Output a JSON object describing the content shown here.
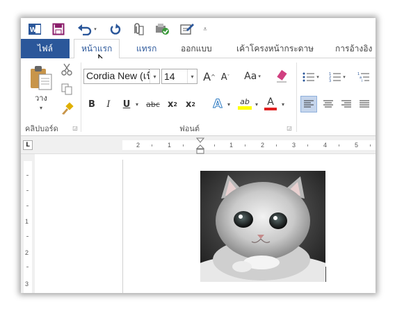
{
  "qat": {
    "icons": [
      "word-logo-icon",
      "save-icon",
      "undo-icon",
      "redo-icon",
      "attach-icon",
      "check-icon",
      "edit-icon",
      "customize-icon"
    ]
  },
  "tabs": {
    "file": "ไฟล์",
    "home": "หน้าแรก",
    "insert": "แทรก",
    "design": "ออกแบบ",
    "layout": "เค้าโครงหน้ากระดาษ",
    "references": "การอ้างอิง"
  },
  "clipboard": {
    "paste_label": "วาง",
    "group_label": "คลิปบอร์ด"
  },
  "font": {
    "font_name": "Cordia New (เนื้",
    "font_size": "14",
    "group_label": "ฟอนต์",
    "change_case": "Aa",
    "bold": "B",
    "italic": "I",
    "underline": "U",
    "strike": "abc",
    "subscript": "x",
    "subscript_small": "2",
    "superscript": "x",
    "superscript_small": "2",
    "grow": "A",
    "shrink": "A",
    "text_effects": "A",
    "highlight": "ab",
    "font_color": "A"
  },
  "ruler": {
    "h_labels": [
      "2",
      "1",
      "1",
      "2",
      "3",
      "4",
      "5"
    ],
    "v_labels": [
      "1",
      "2",
      "3"
    ],
    "tab_selector": "L"
  },
  "colors": {
    "accent": "#2b579a",
    "highlight_yellow": "#ffff00",
    "font_red": "#e02020",
    "align_active": "#c5d5ec"
  }
}
